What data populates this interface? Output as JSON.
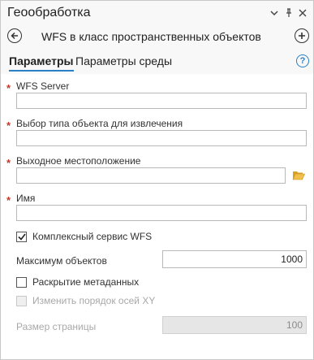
{
  "window": {
    "title": "Геообработка",
    "icons": [
      "chevron-down-icon",
      "pin-icon",
      "close-icon"
    ]
  },
  "header": {
    "tool_title": "WFS в класс пространственных объектов",
    "back_icon": "back-arrow-icon",
    "add_icon": "add-icon"
  },
  "tabs": [
    {
      "label": "Параметры",
      "active": true
    },
    {
      "label": "Параметры среды",
      "active": false
    }
  ],
  "help_label": "?",
  "params": {
    "wfs_server": {
      "label": "WFS Server",
      "value": "",
      "required": true
    },
    "feature_type": {
      "label": "Выбор типа объекта для извлечения",
      "value": "",
      "required": true
    },
    "output_location": {
      "label": "Выходное местоположение",
      "value": "",
      "required": true,
      "icon": "folder-icon"
    },
    "name": {
      "label": "Имя",
      "value": "",
      "required": true
    },
    "complex_wfs": {
      "label": "Комплексный сервис WFS",
      "checked": true
    },
    "max_features": {
      "label": "Максимум объектов",
      "value": "1000"
    },
    "expose_metadata": {
      "label": "Раскрытие метаданных",
      "checked": false
    },
    "swap_xy": {
      "label": "Изменить порядок осей XY",
      "checked": false,
      "disabled": true
    },
    "page_size": {
      "label": "Размер страницы",
      "value": "100",
      "disabled": true
    }
  },
  "required_marker": "*",
  "colors": {
    "accent": "#2b7fc4",
    "required": "#c0392b",
    "folder": "#e8b33a"
  }
}
